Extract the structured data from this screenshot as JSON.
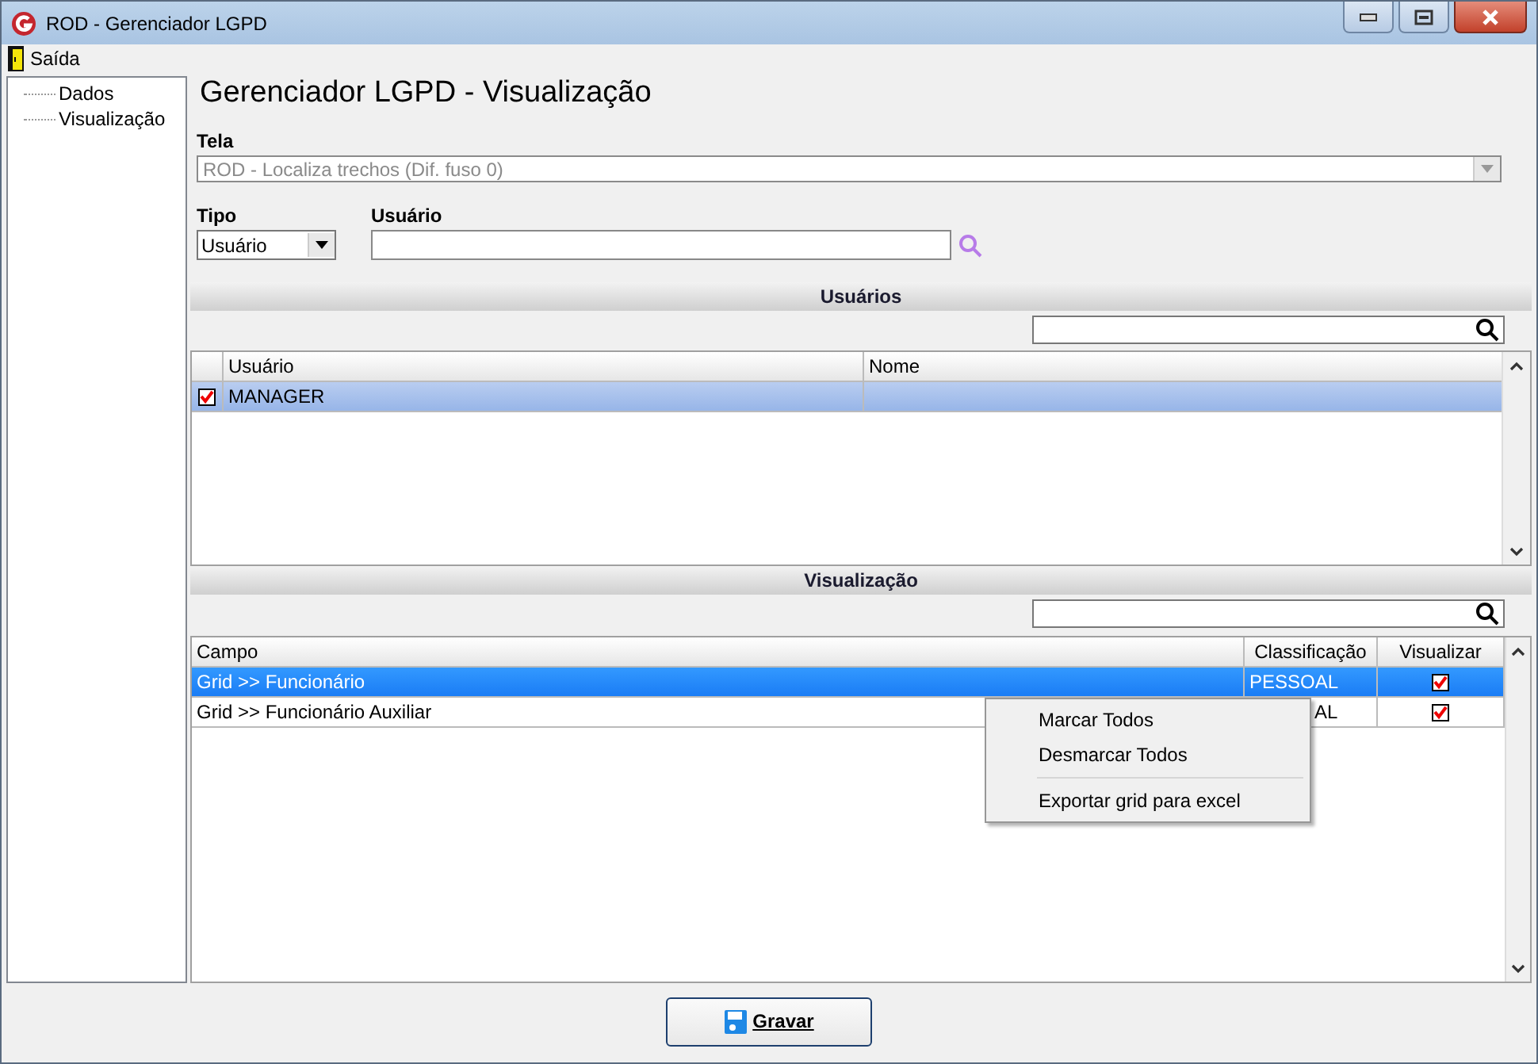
{
  "window": {
    "title": "ROD - Gerenciador LGPD"
  },
  "menu": [
    {
      "label": "Saída"
    }
  ],
  "tree": [
    {
      "label": "Dados",
      "selected": false
    },
    {
      "label": "Visualização",
      "selected": false
    }
  ],
  "heading": "Gerenciador LGPD - Visualização",
  "tela": {
    "label": "Tela",
    "value": "ROD - Localiza trechos (Dif. fuso 0)",
    "disabled": true
  },
  "tipo": {
    "label": "Tipo",
    "value": "Usuário"
  },
  "usuario": {
    "label": "Usuário"
  },
  "usuarios_section": {
    "title": "Usuários",
    "columns": [
      "Usuário",
      "Nome"
    ],
    "rows": [
      {
        "checked": true,
        "selected": true,
        "cells": [
          "MANAGER",
          ""
        ]
      }
    ]
  },
  "visualizacao_section": {
    "title": "Visualização",
    "columns": [
      "Campo",
      "Classificação",
      "Visualizar"
    ],
    "rows": [
      {
        "selected": true,
        "covered": false,
        "campo": "Grid >> Funcionário",
        "classificacao": "PESSOAL",
        "checked": true
      },
      {
        "selected": false,
        "covered": true,
        "campo": "Grid >> Funcionário Auxiliar",
        "classificacao": "AL",
        "checked": true
      }
    ]
  },
  "context_menu": [
    {
      "label": "Marcar Todos",
      "kind": "item"
    },
    {
      "label": "Desmarcar Todos",
      "kind": "item"
    },
    {
      "kind": "separator"
    },
    {
      "label": "Exportar grid para excel",
      "kind": "item"
    }
  ],
  "save_button": {
    "label": "Gravar"
  }
}
